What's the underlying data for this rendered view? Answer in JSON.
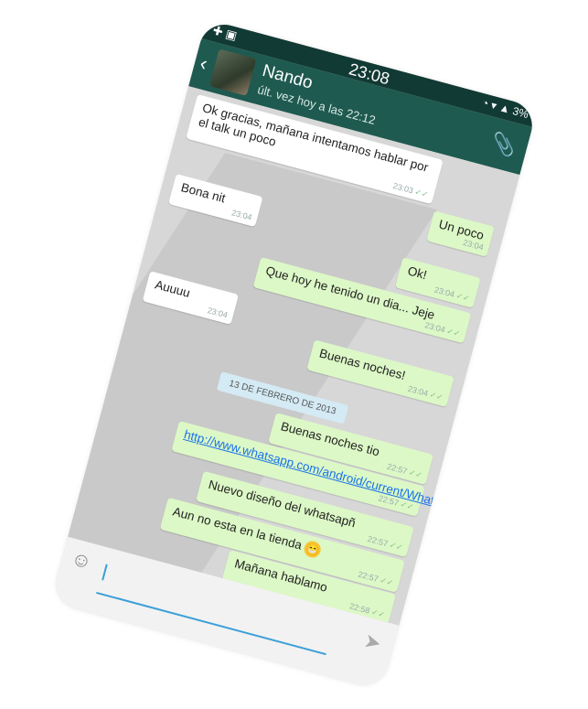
{
  "status": {
    "time": "23:08",
    "left_icons": "✚ ▣",
    "right_icons": "◔ ▾ ▲ 3%"
  },
  "header": {
    "back_icon": "‹",
    "avatar_icon": "contact-avatar",
    "name": "Nando",
    "last_seen": "últ. vez hoy a las 22:12",
    "attach_icon": "📎"
  },
  "date_chip": "13 DE FEBRERO DE 2013",
  "messages": [
    {
      "dir": "in",
      "text": "Ok gracias, mañana intentamos hablar por el talk un poco",
      "time": "23:03",
      "ticks": "✓✓"
    },
    {
      "dir": "out",
      "text": "Un poco",
      "time": "23:04",
      "ticks": ""
    },
    {
      "dir": "in",
      "text": "Bona nit",
      "time": "23:04",
      "ticks": ""
    },
    {
      "dir": "out",
      "text": "Ok!",
      "time": "23:04",
      "ticks": "✓✓"
    },
    {
      "dir": "out",
      "text": "Que hoy he tenido un dia... Jeje",
      "time": "23:04",
      "ticks": "✓✓"
    },
    {
      "dir": "in",
      "text": "Auuuu",
      "time": "23:04",
      "ticks": ""
    },
    {
      "dir": "out",
      "text": "Buenas noches!",
      "time": "23:04",
      "ticks": "✓✓"
    },
    {
      "dir": "out",
      "text": "Buenas noches tio",
      "time": "22:57",
      "ticks": "✓✓"
    },
    {
      "dir": "out",
      "text": "http://www.whatsapp.com/android/current/WhatsApp.apk",
      "time": "22:57",
      "ticks": "✓✓",
      "is_link": true
    },
    {
      "dir": "out",
      "text": "Nuevo diseño del whatsapñ",
      "time": "22:57",
      "ticks": "✓✓"
    },
    {
      "dir": "out",
      "text": "Aun no esta en la tienda",
      "time": "22:57",
      "ticks": "✓✓",
      "emoji": "😁"
    },
    {
      "dir": "out",
      "text": "Mañana hablamo",
      "time": "22:58",
      "ticks": "✓✓"
    }
  ],
  "input": {
    "smile_icon": "☺",
    "send_icon": "➤"
  }
}
